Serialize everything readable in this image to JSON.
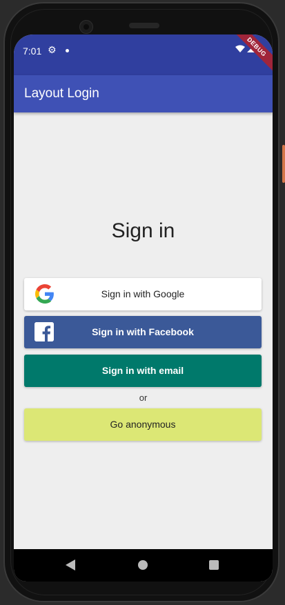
{
  "status": {
    "time": "7:01",
    "debug": "DEBUG"
  },
  "app_bar": {
    "title": "Layout Login"
  },
  "main": {
    "heading": "Sign in",
    "google_label": "Sign in with Google",
    "facebook_label": "Sign in with Facebook",
    "email_label": "Sign in with email",
    "or_text": "or",
    "anonymous_label": "Go anonymous"
  },
  "colors": {
    "status_bar": "#303f9f",
    "app_bar": "#3f51b5",
    "facebook": "#3b5998",
    "email": "#00796b",
    "anonymous": "#dce775",
    "background": "#eeeeee"
  },
  "icons": {
    "status": [
      "gear-icon",
      "wifi-icon",
      "signal-icon",
      "battery-icon"
    ],
    "nav": [
      "back-icon",
      "home-icon",
      "recents-icon"
    ],
    "buttons": [
      "google-logo-icon",
      "facebook-logo-icon"
    ]
  }
}
